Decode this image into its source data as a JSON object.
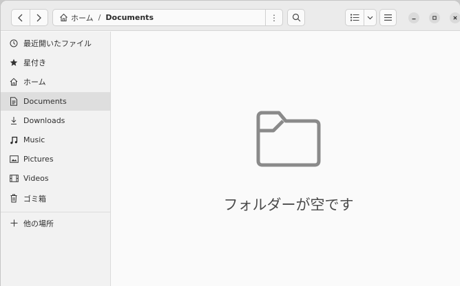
{
  "headerbar": {
    "path_home": "ホーム",
    "path_separator": "/",
    "path_current": "Documents",
    "path_menu_glyph": "⋮"
  },
  "sidebar": {
    "items": [
      {
        "label": "最近開いたファイル",
        "icon": "clock-icon"
      },
      {
        "label": "星付き",
        "icon": "star-icon"
      },
      {
        "label": "ホーム",
        "icon": "home-icon"
      },
      {
        "label": "Documents",
        "icon": "document-icon",
        "active": true
      },
      {
        "label": "Downloads",
        "icon": "download-icon"
      },
      {
        "label": "Music",
        "icon": "music-icon"
      },
      {
        "label": "Pictures",
        "icon": "picture-icon"
      },
      {
        "label": "Videos",
        "icon": "video-icon"
      },
      {
        "label": "ゴミ箱",
        "icon": "trash-icon"
      }
    ],
    "other_locations": {
      "label": "他の場所",
      "icon": "plus-icon"
    }
  },
  "content": {
    "empty_message": "フォルダーが空です"
  },
  "colors": {
    "window_bg": "#fafafa",
    "sidebar_bg": "#f2f2f2",
    "active_item_bg": "#dedede",
    "headerbar_bg": "#ebebeb",
    "empty_icon": "#8a8a8a"
  }
}
